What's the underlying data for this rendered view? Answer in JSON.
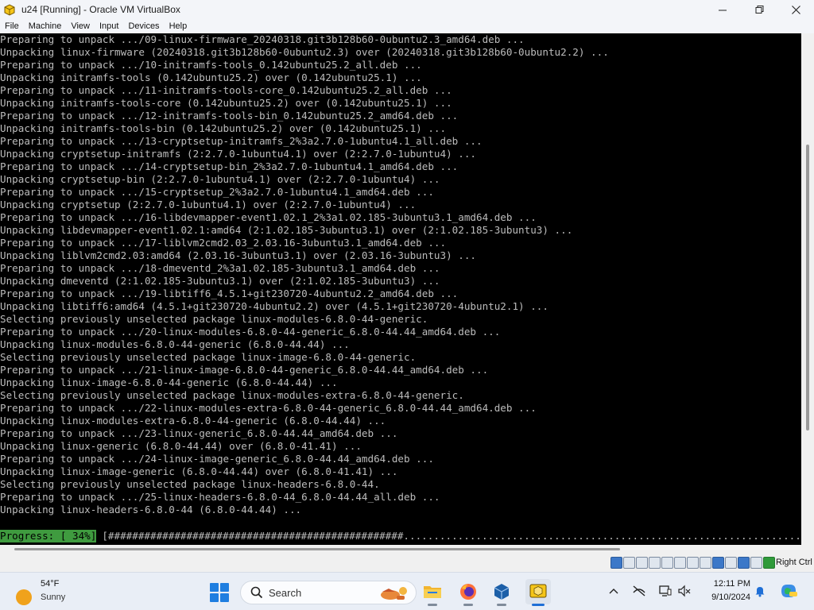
{
  "window": {
    "title": "u24 [Running] - Oracle VM VirtualBox",
    "icon": "virtualbox-cube-icon",
    "controls": [
      "minimize-icon",
      "maximize-icon",
      "close-icon"
    ]
  },
  "menu": [
    "File",
    "Machine",
    "View",
    "Input",
    "Devices",
    "Help"
  ],
  "console": {
    "lines": [
      "Preparing to unpack .../09-linux-firmware_20240318.git3b128b60-0ubuntu2.3_amd64.deb ...",
      "Unpacking linux-firmware (20240318.git3b128b60-0ubuntu2.3) over (20240318.git3b128b60-0ubuntu2.2) ...",
      "Preparing to unpack .../10-initramfs-tools_0.142ubuntu25.2_all.deb ...",
      "Unpacking initramfs-tools (0.142ubuntu25.2) over (0.142ubuntu25.1) ...",
      "Preparing to unpack .../11-initramfs-tools-core_0.142ubuntu25.2_all.deb ...",
      "Unpacking initramfs-tools-core (0.142ubuntu25.2) over (0.142ubuntu25.1) ...",
      "Preparing to unpack .../12-initramfs-tools-bin_0.142ubuntu25.2_amd64.deb ...",
      "Unpacking initramfs-tools-bin (0.142ubuntu25.2) over (0.142ubuntu25.1) ...",
      "Preparing to unpack .../13-cryptsetup-initramfs_2%3a2.7.0-1ubuntu4.1_all.deb ...",
      "Unpacking cryptsetup-initramfs (2:2.7.0-1ubuntu4.1) over (2:2.7.0-1ubuntu4) ...",
      "Preparing to unpack .../14-cryptsetup-bin_2%3a2.7.0-1ubuntu4.1_amd64.deb ...",
      "Unpacking cryptsetup-bin (2:2.7.0-1ubuntu4.1) over (2:2.7.0-1ubuntu4) ...",
      "Preparing to unpack .../15-cryptsetup_2%3a2.7.0-1ubuntu4.1_amd64.deb ...",
      "Unpacking cryptsetup (2:2.7.0-1ubuntu4.1) over (2:2.7.0-1ubuntu4) ...",
      "Preparing to unpack .../16-libdevmapper-event1.02.1_2%3a1.02.185-3ubuntu3.1_amd64.deb ...",
      "Unpacking libdevmapper-event1.02.1:amd64 (2:1.02.185-3ubuntu3.1) over (2:1.02.185-3ubuntu3) ...",
      "Preparing to unpack .../17-liblvm2cmd2.03_2.03.16-3ubuntu3.1_amd64.deb ...",
      "Unpacking liblvm2cmd2.03:amd64 (2.03.16-3ubuntu3.1) over (2.03.16-3ubuntu3) ...",
      "Preparing to unpack .../18-dmeventd_2%3a1.02.185-3ubuntu3.1_amd64.deb ...",
      "Unpacking dmeventd (2:1.02.185-3ubuntu3.1) over (2:1.02.185-3ubuntu3) ...",
      "Preparing to unpack .../19-libtiff6_4.5.1+git230720-4ubuntu2.2_amd64.deb ...",
      "Unpacking libtiff6:amd64 (4.5.1+git230720-4ubuntu2.2) over (4.5.1+git230720-4ubuntu2.1) ...",
      "Selecting previously unselected package linux-modules-6.8.0-44-generic.",
      "Preparing to unpack .../20-linux-modules-6.8.0-44-generic_6.8.0-44.44_amd64.deb ...",
      "Unpacking linux-modules-6.8.0-44-generic (6.8.0-44.44) ...",
      "Selecting previously unselected package linux-image-6.8.0-44-generic.",
      "Preparing to unpack .../21-linux-image-6.8.0-44-generic_6.8.0-44.44_amd64.deb ...",
      "Unpacking linux-image-6.8.0-44-generic (6.8.0-44.44) ...",
      "Selecting previously unselected package linux-modules-extra-6.8.0-44-generic.",
      "Preparing to unpack .../22-linux-modules-extra-6.8.0-44-generic_6.8.0-44.44_amd64.deb ...",
      "Unpacking linux-modules-extra-6.8.0-44-generic (6.8.0-44.44) ...",
      "Preparing to unpack .../23-linux-generic_6.8.0-44.44_amd64.deb ...",
      "Unpacking linux-generic (6.8.0-44.44) over (6.8.0-41.41) ...",
      "Preparing to unpack .../24-linux-image-generic_6.8.0-44.44_amd64.deb ...",
      "Unpacking linux-image-generic (6.8.0-44.44) over (6.8.0-41.41) ...",
      "Selecting previously unselected package linux-headers-6.8.0-44.",
      "Preparing to unpack .../25-linux-headers-6.8.0-44_6.8.0-44.44_all.deb ...",
      "Unpacking linux-headers-6.8.0-44 (6.8.0-44.44) ..."
    ],
    "progress_label": "Progress: [ 34%]",
    "progress_bar": "[#################################################.................................................................................................]",
    "progress_percent": 34
  },
  "statusbar": {
    "icons": [
      "hard-disk-icon",
      "optical-drive-icon",
      "audio-icon",
      "network-icon",
      "usb-icon",
      "shared-folders-icon",
      "display-icon",
      "video-capture-icon",
      "recording-icon",
      "cpu-icon",
      "guest-additions-icon",
      "mouse-integration-icon",
      "keyboard-icon"
    ],
    "host_key": "Right Ctrl"
  },
  "taskbar": {
    "weather_temp": "54°F",
    "weather_condition": "Sunny",
    "search_placeholder": "Search",
    "apps": [
      "file-explorer-icon",
      "firefox-icon",
      "virtualbox-icon",
      "virtualbox-vm-icon"
    ],
    "tray_icons": [
      "chevron-up-icon",
      "network-disconnected-icon",
      "display-icon",
      "volume-muted-icon"
    ],
    "clock_time": "12:11 PM",
    "clock_date": "9/10/2024",
    "accent": "#1f6fd6"
  }
}
